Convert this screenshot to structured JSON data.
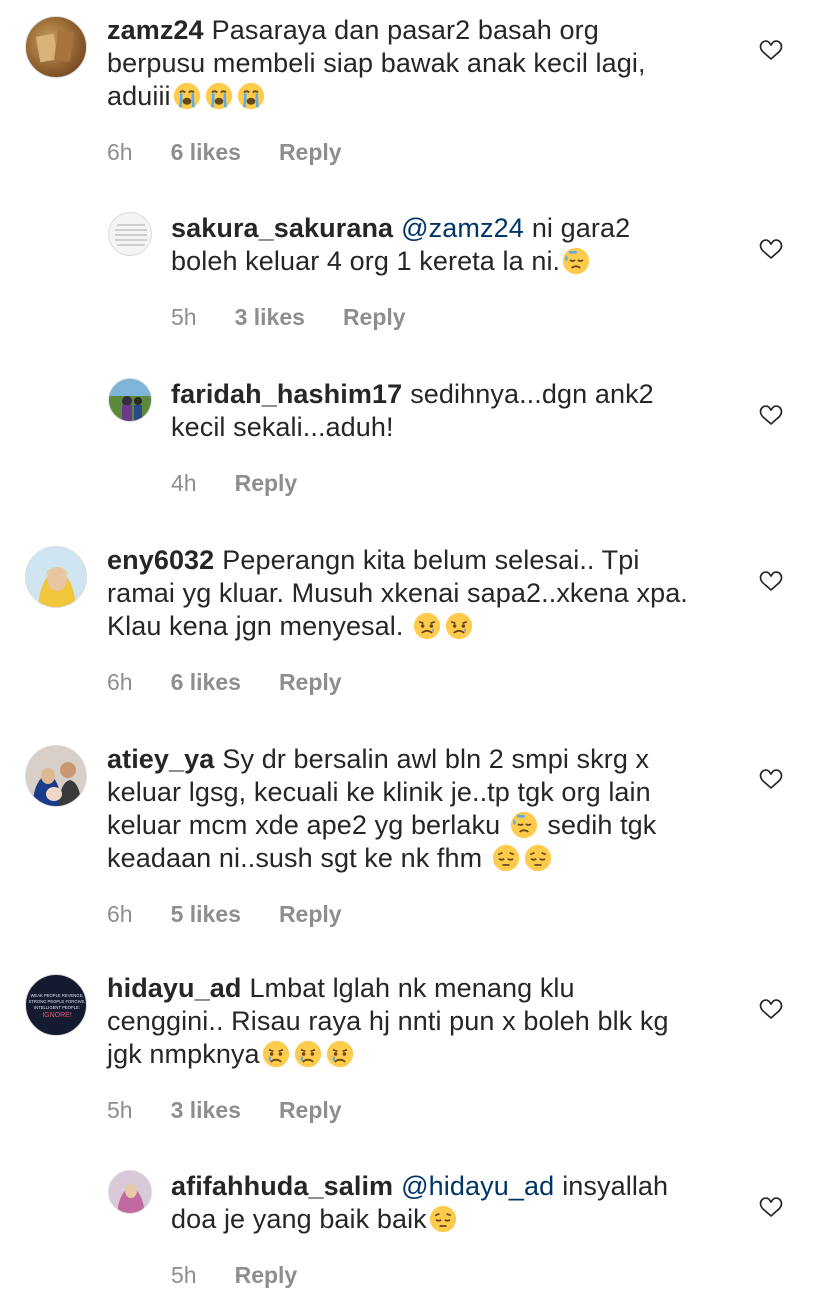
{
  "comments": [
    {
      "user": "zamz24",
      "mention": "",
      "text_lines": [
        "Pasaraya dan pasar2 basah org",
        "berpusu membeli siap bawak anak kecil lagi,",
        "aduiii"
      ],
      "emoji_after": [
        "😭",
        "😭",
        "😭"
      ],
      "time": "6h",
      "likes": "6 likes",
      "reply": "Reply"
    },
    {
      "user": "sakura_sakurana",
      "mention": "@zamz24",
      "text_lines": [
        "ni gara2",
        "boleh keluar 4 org 1 kereta la ni."
      ],
      "emoji_after": [
        "😓"
      ],
      "time": "5h",
      "likes": "3 likes",
      "reply": "Reply"
    },
    {
      "user": "faridah_hashim17",
      "mention": "",
      "text_lines": [
        "sedihnya...dgn ank2",
        "kecil sekali...aduh!"
      ],
      "emoji_after": [],
      "time": "4h",
      "likes": "",
      "reply": "Reply"
    },
    {
      "user": "eny6032",
      "mention": "",
      "text_lines": [
        "Peperangn kita belum selesai.. Tpi",
        "ramai yg kluar. Musuh xkenai sapa2..xkena xpa.",
        "Klau kena jgn menyesal."
      ],
      "emoji_after": [
        "😥",
        "😥"
      ],
      "time": "6h",
      "likes": "6 likes",
      "reply": "Reply"
    },
    {
      "user": "atiey_ya",
      "mention": "",
      "text_lines": [
        "Sy dr bersalin awl bln 2 smpi skrg x",
        "keluar lgsg, kecuali ke klinik je..tp tgk org lain",
        "keluar mcm xde ape2 yg berlaku",
        "keadaan ni..sush sgt ke nk fhm"
      ],
      "emoji_mid": "😓",
      "text_after_mid": "sedih tgk",
      "emoji_after": [
        "😔",
        "😔"
      ],
      "time": "6h",
      "likes": "5 likes",
      "reply": "Reply"
    },
    {
      "user": "hidayu_ad",
      "mention": "",
      "text_lines": [
        "Lmbat lglah nk menang klu",
        "cenggini.. Risau raya hj nnti pun x boleh blk kg",
        "jgk nmpknya"
      ],
      "emoji_after": [
        "😢",
        "😢",
        "😢"
      ],
      "time": "5h",
      "likes": "3 likes",
      "reply": "Reply"
    },
    {
      "user": "afifahhuda_salim",
      "mention": "@hidayu_ad",
      "text_lines": [
        "insyallah",
        "doa je yang baik baik"
      ],
      "emoji_after": [
        "😔"
      ],
      "time": "5h",
      "likes": "",
      "reply": "Reply"
    }
  ],
  "avatar_texts": {
    "hidayu": [
      "WEAK PEOPLE REVENGE,",
      "STRONG PEOPLE FORGIVE,",
      "INTELLIGENT PEOPLE:",
      "IGNORE!"
    ]
  },
  "colors": {
    "text": "#262626",
    "meta": "#8e8e8e",
    "mention": "#003569"
  }
}
